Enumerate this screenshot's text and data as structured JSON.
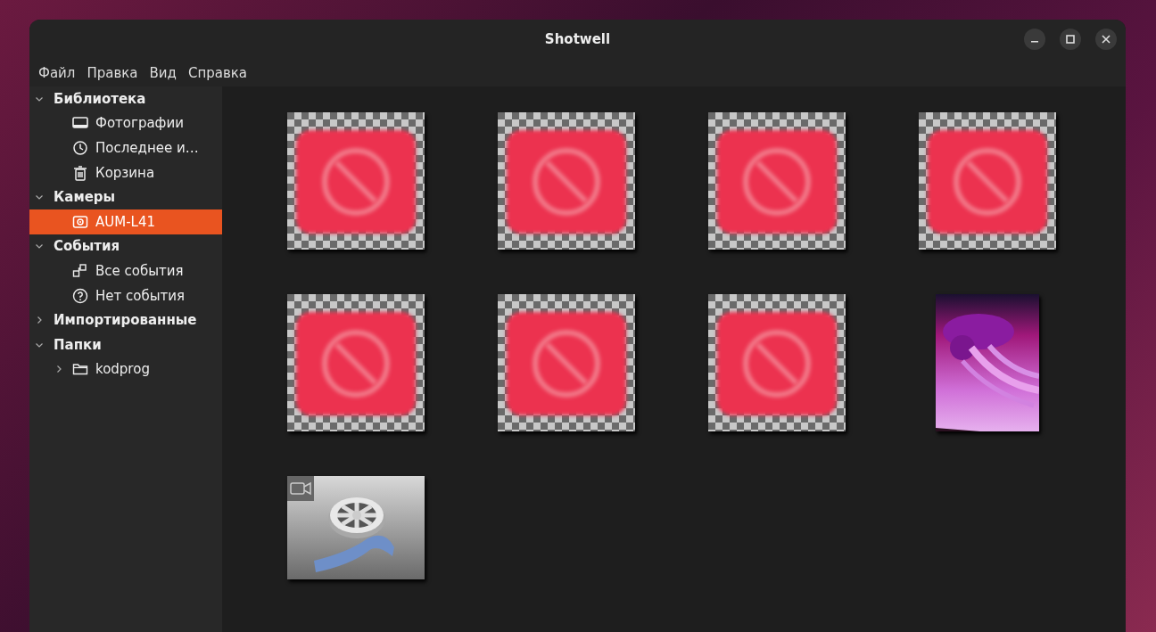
{
  "window": {
    "title": "Shotwell"
  },
  "menu": [
    "Файл",
    "Правка",
    "Вид",
    "Справка"
  ],
  "sidebar": [
    {
      "label": "Библиотека",
      "expanded": true,
      "children": [
        {
          "label": "Фотографии",
          "kind": "photos",
          "selected": false
        },
        {
          "label": "Последнее и…",
          "kind": "recent",
          "selected": false
        },
        {
          "label": "Корзина",
          "kind": "trash",
          "selected": false
        }
      ]
    },
    {
      "label": "Камеры",
      "expanded": true,
      "children": [
        {
          "label": "AUM-L41",
          "kind": "camera",
          "selected": true
        }
      ]
    },
    {
      "label": "События",
      "expanded": true,
      "children": [
        {
          "label": "Все события",
          "kind": "events",
          "selected": false
        },
        {
          "label": "Нет события",
          "kind": "unknown",
          "selected": false
        }
      ]
    },
    {
      "label": "Импортированные",
      "expanded": false
    },
    {
      "label": "Папки",
      "expanded": true,
      "children": [
        {
          "label": "kodprog",
          "kind": "folder",
          "selected": false,
          "expanded": false
        }
      ]
    }
  ],
  "thumbnails": [
    {
      "kind": "broken"
    },
    {
      "kind": "broken"
    },
    {
      "kind": "broken"
    },
    {
      "kind": "broken"
    },
    {
      "kind": "broken"
    },
    {
      "kind": "broken"
    },
    {
      "kind": "broken"
    },
    {
      "kind": "picture"
    },
    {
      "kind": "video"
    }
  ]
}
